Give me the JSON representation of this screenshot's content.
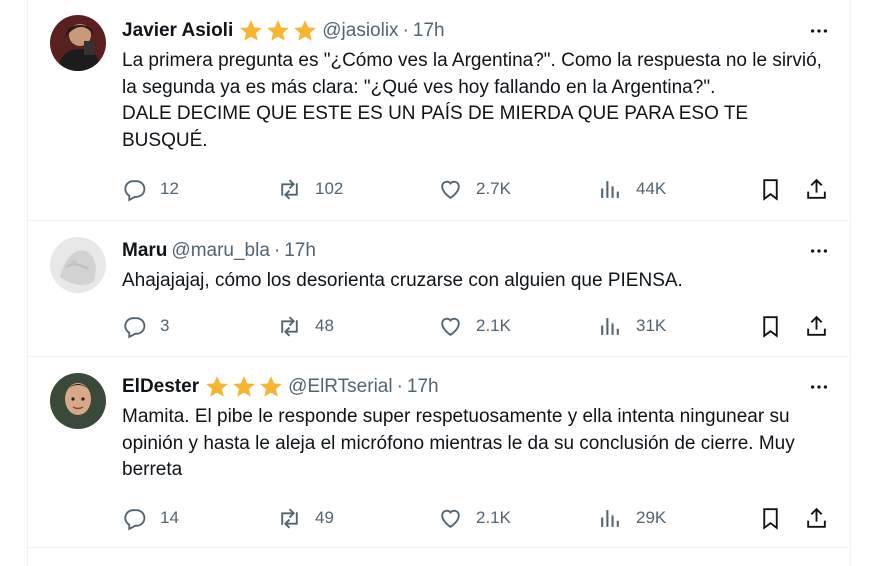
{
  "tweets": [
    {
      "name": "Javier Asioli",
      "handle": "@jasiolix",
      "time": "17h",
      "verified_stars": 3,
      "text": "La primera pregunta es \"¿Cómo ves la Argentina?\". Como la respuesta no le sirvió, la segunda ya es más clara: \"¿Qué ves hoy fallando en la Argentina?\".\nDALE DECIME QUE ESTE ES UN PAÍS DE MIERDA QUE PARA ESO TE BUSQUÉ.",
      "replies": "12",
      "retweets": "102",
      "likes": "2.7K",
      "views": "44K"
    },
    {
      "name": "Maru",
      "handle": "@maru_bla",
      "time": "17h",
      "verified_stars": 0,
      "text": "Ahajajajaj, cómo los desorienta cruzarse con alguien que PIENSA.",
      "replies": "3",
      "retweets": "48",
      "likes": "2.1K",
      "views": "31K"
    },
    {
      "name": "ElDester",
      "handle": "@ElRTserial",
      "time": "17h",
      "verified_stars": 3,
      "text": "Mamita. El pibe le responde super respetuosamente y ella intenta ningunear su opinión y hasta le aleja el micrófono mientras le da su conclusión de cierre. Muy berreta",
      "replies": "14",
      "retweets": "49",
      "likes": "2.1K",
      "views": "29K"
    }
  ],
  "colors": {
    "text": "#0f1419",
    "muted": "#536471",
    "star": "#f7b531",
    "border": "#eff3f4"
  },
  "icons": [
    "reply-icon",
    "retweet-icon",
    "like-icon",
    "views-icon",
    "bookmark-icon",
    "share-icon",
    "more-icon",
    "star-icon"
  ]
}
